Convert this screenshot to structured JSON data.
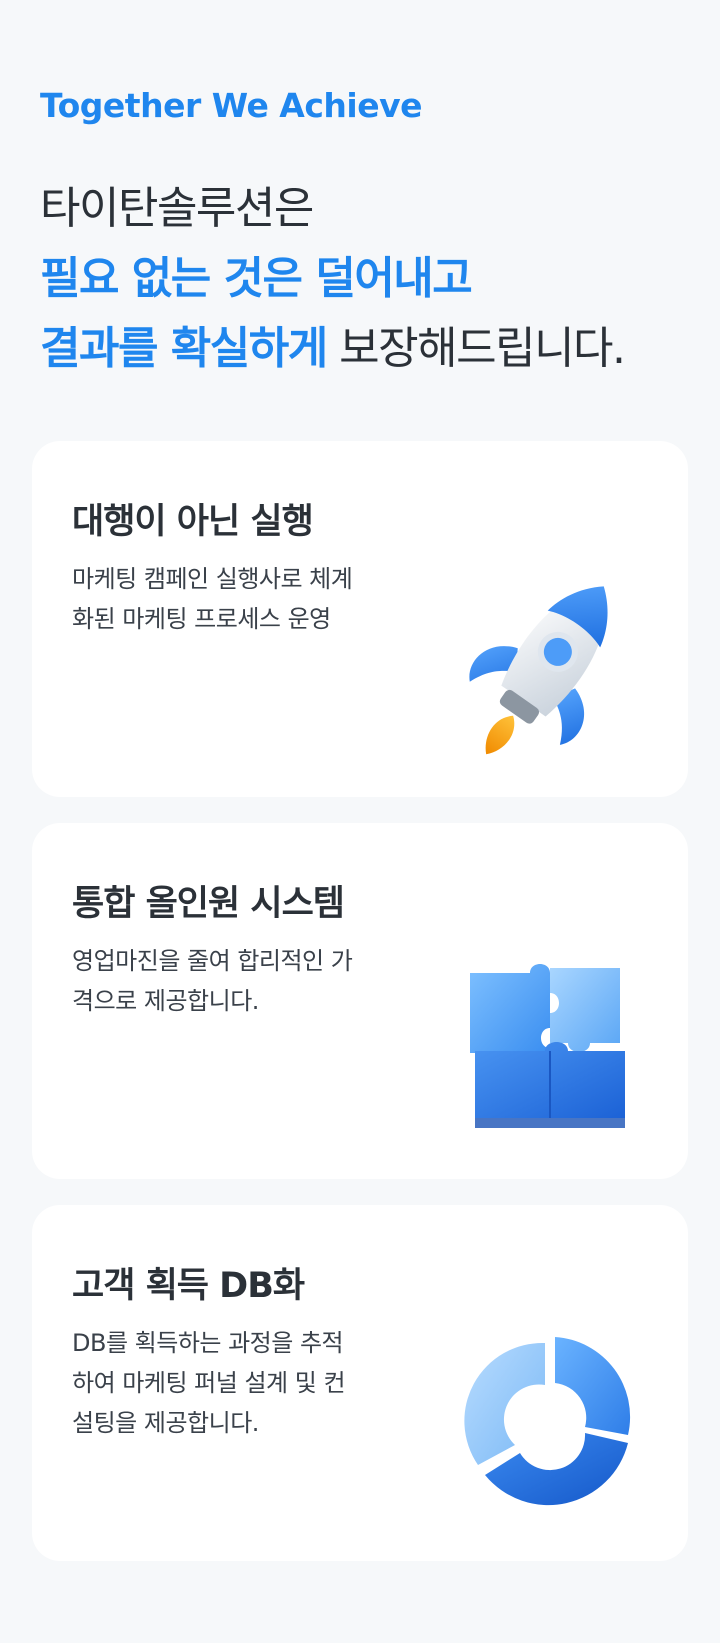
{
  "header": {
    "eyebrow": "Together We Achieve",
    "headline_line1": "타이탄솔루션은",
    "headline_line2_accent": "필요 없는 것은 덜어내고",
    "headline_line3_accent": "결과를 확실하게",
    "headline_line3_rest": " 보장해드립니다."
  },
  "cards": [
    {
      "title": "대행이 아닌 실행",
      "description": "마케팅 캠페인 실행사로 체계\n화된 마케팅 프로세스 운영",
      "icon": "rocket-icon"
    },
    {
      "title": "통합 올인원 시스템",
      "description": "영업마진을 줄여 합리적인 가\n격으로 제공합니다.",
      "icon": "puzzle-icon"
    },
    {
      "title": "고객 획득 DB화",
      "description": "DB를 획득하는 과정을 추적\n하여 마케팅 퍼널 설계 및 컨\n설팅을 제공합니다.",
      "icon": "donut-chart-icon"
    }
  ],
  "colors": {
    "accent": "#1f86ee",
    "text": "#2b3138",
    "background": "#f6f8fa",
    "card": "#ffffff"
  }
}
